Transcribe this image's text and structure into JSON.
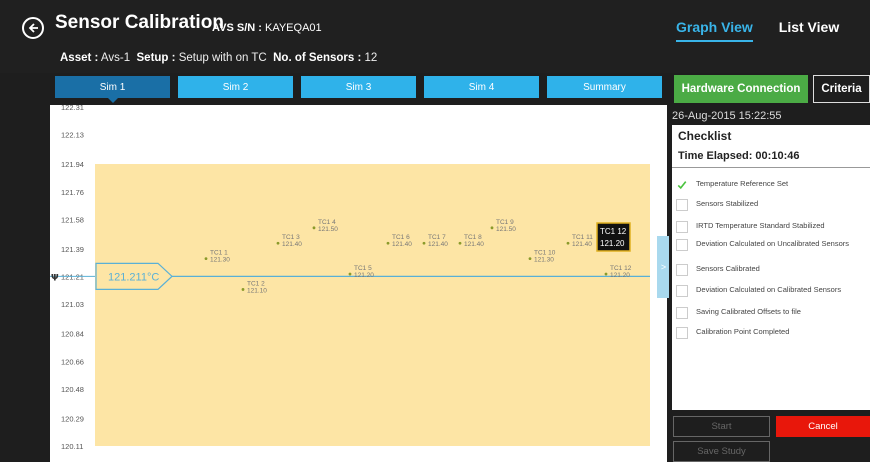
{
  "header": {
    "title": "Sensor Calibration",
    "serial_label": "AVS S/N :",
    "serial_value": "KAYEQA01",
    "asset_label": "Asset :",
    "asset_value": "Avs-1",
    "setup_label": "Setup :",
    "setup_value": "Setup with on TC",
    "sensors_label": "No. of Sensors :",
    "sensors_value": "12",
    "view_tabs": [
      {
        "label": "Graph View",
        "active": true
      },
      {
        "label": "List View",
        "active": false
      }
    ]
  },
  "sim_tabs": [
    {
      "label": "Sim 1",
      "active": true
    },
    {
      "label": "Sim 2",
      "active": false
    },
    {
      "label": "Sim 3",
      "active": false
    },
    {
      "label": "Sim 4",
      "active": false
    },
    {
      "label": "Summary",
      "active": false
    }
  ],
  "actions": {
    "hardware_connection": "Hardware Connection",
    "criteria": "Criteria",
    "start": "Start",
    "cancel": "Cancel",
    "save_study": "Save Study"
  },
  "colors": {
    "accent": "#2fb2ea",
    "active_tab": "#1a6fa6",
    "band": "#fde5a5",
    "line": "#5ab0d6",
    "green": "#4bab45",
    "red": "#e8170b"
  },
  "chart_data": {
    "type": "scatter",
    "y_ticks": [
      "122.31",
      "122.13",
      "121.94",
      "121.76",
      "121.58",
      "121.39",
      "121.21",
      "121.03",
      "120.84",
      "120.66",
      "120.48",
      "120.29",
      "120.11"
    ],
    "ylim": [
      120.11,
      122.31
    ],
    "band": [
      120.11,
      121.94
    ],
    "reference_value": 121.211,
    "reference_label": "121.211°C",
    "points": [
      {
        "name": "TC1 1",
        "label": "121.30",
        "value": 121.3
      },
      {
        "name": "TC1 2",
        "label": "121.10",
        "value": 121.1
      },
      {
        "name": "TC1 3",
        "label": "121.40",
        "value": 121.4
      },
      {
        "name": "TC1 4",
        "label": "121.50",
        "value": 121.5
      },
      {
        "name": "TC1 5",
        "label": "121.20",
        "value": 121.2
      },
      {
        "name": "TC1 6",
        "label": "121.40",
        "value": 121.4
      },
      {
        "name": "TC1 7",
        "label": "121.40",
        "value": 121.4
      },
      {
        "name": "TC1 8",
        "label": "121.40",
        "value": 121.4
      },
      {
        "name": "TC1 9",
        "label": "121.50",
        "value": 121.5
      },
      {
        "name": "TC1 10",
        "label": "121.30",
        "value": 121.3
      },
      {
        "name": "TC1 11",
        "label": "121.40",
        "value": 121.4
      },
      {
        "name": "TC1 12",
        "label": "121.20",
        "value": 121.2
      }
    ],
    "highlight": {
      "name": "TC1 12",
      "value": "121.20"
    }
  },
  "panel": {
    "datetime": "26-Aug-2015 15:22:55",
    "checklist_title": "Checklist",
    "time_elapsed": "Time Elapsed: 00:10:46",
    "items": [
      {
        "label": "Temperature Reference Set",
        "done": true
      },
      {
        "label": "Sensors Stabilized",
        "done": false
      },
      {
        "label": "IRTD Temperature Standard Stabilized",
        "done": false
      },
      {
        "label": "Deviation Calculated on Uncalibrated Sensors",
        "done": false
      },
      {
        "label": "Sensors Calibrated",
        "done": false
      },
      {
        "label": "Deviation Calculated on Calibrated Sensors",
        "done": false
      },
      {
        "label": "Saving Calibrated Offsets to file",
        "done": false
      },
      {
        "label": "Calibration Point Completed",
        "done": false
      }
    ]
  }
}
